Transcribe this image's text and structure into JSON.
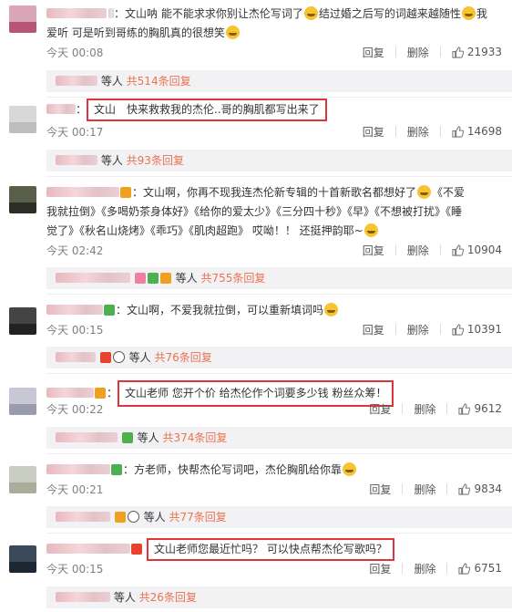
{
  "comments": [
    {
      "name_suffix": "：文山呐 能不能求求你别让杰伦写词了",
      "text_b": "结过婚之后写的词越来越随性",
      "text_c": "我",
      "line2": "爱听 可是听到哥练的胸肌真的很想笑",
      "time": "今天 00:08",
      "reply": "回复",
      "delete": "删除",
      "likes": "21933",
      "reply_people": "等人",
      "reply_count": "共514条回复"
    },
    {
      "highlight_prefix": "：",
      "text": "文山　快来救救我的杰伦..哥的胸肌都写出来了",
      "time": "今天 00:17",
      "reply": "回复",
      "delete": "删除",
      "likes": "14698",
      "reply_people": "等人",
      "reply_count": "共93条回复"
    },
    {
      "text_a": "：文山啊，你再不现我连杰伦新专辑的十首新歌名都想好了",
      "text_b": "《不爱",
      "line2": "我就拉倒》《多喝奶茶身体好》《给你的爱太少》《三分四十秒》《早》《不想被打扰》《睡",
      "line3a": "觉了》《秋名山烧烤》《乖巧》《肌肉超跑》 哎呦！！ 还挺押韵耶~",
      "time": "今天 02:42",
      "reply": "回复",
      "delete": "删除",
      "likes": "10904",
      "reply_people": "等人",
      "reply_count": "共755条回复"
    },
    {
      "text": "：文山啊，不爱我就拉倒，可以重新填词吗",
      "time": "今天 00:15",
      "reply": "回复",
      "delete": "删除",
      "likes": "10391",
      "reply_people": "等人",
      "reply_count": "共76条回复"
    },
    {
      "highlight": "文山老师 您开个价 给杰伦作个词要多少钱 粉丝众筹！",
      "time": "今天 00:22",
      "reply": "回复",
      "delete": "删除",
      "likes": "9612",
      "reply_people": "等人",
      "reply_count": "共374条回复"
    },
    {
      "text": "：方老师，快帮杰伦写词吧，杰伦胸肌给你靠",
      "time": "今天 00:21",
      "reply": "回复",
      "delete": "删除",
      "likes": "9834",
      "reply_people": "等人",
      "reply_count": "共77条回复"
    },
    {
      "highlight": "文山老师您最近忙吗？ 可以快点帮杰伦写歌吗？",
      "time": "今天 00:15",
      "reply": "回复",
      "delete": "删除",
      "likes": "6751",
      "reply_people": "等人",
      "reply_count": "共26条回复"
    }
  ],
  "colors": {
    "highlight_border": "#e0343a",
    "reply_count": "#eb7350",
    "meta": "#808080",
    "reply_bg": "#f2f2f5"
  }
}
